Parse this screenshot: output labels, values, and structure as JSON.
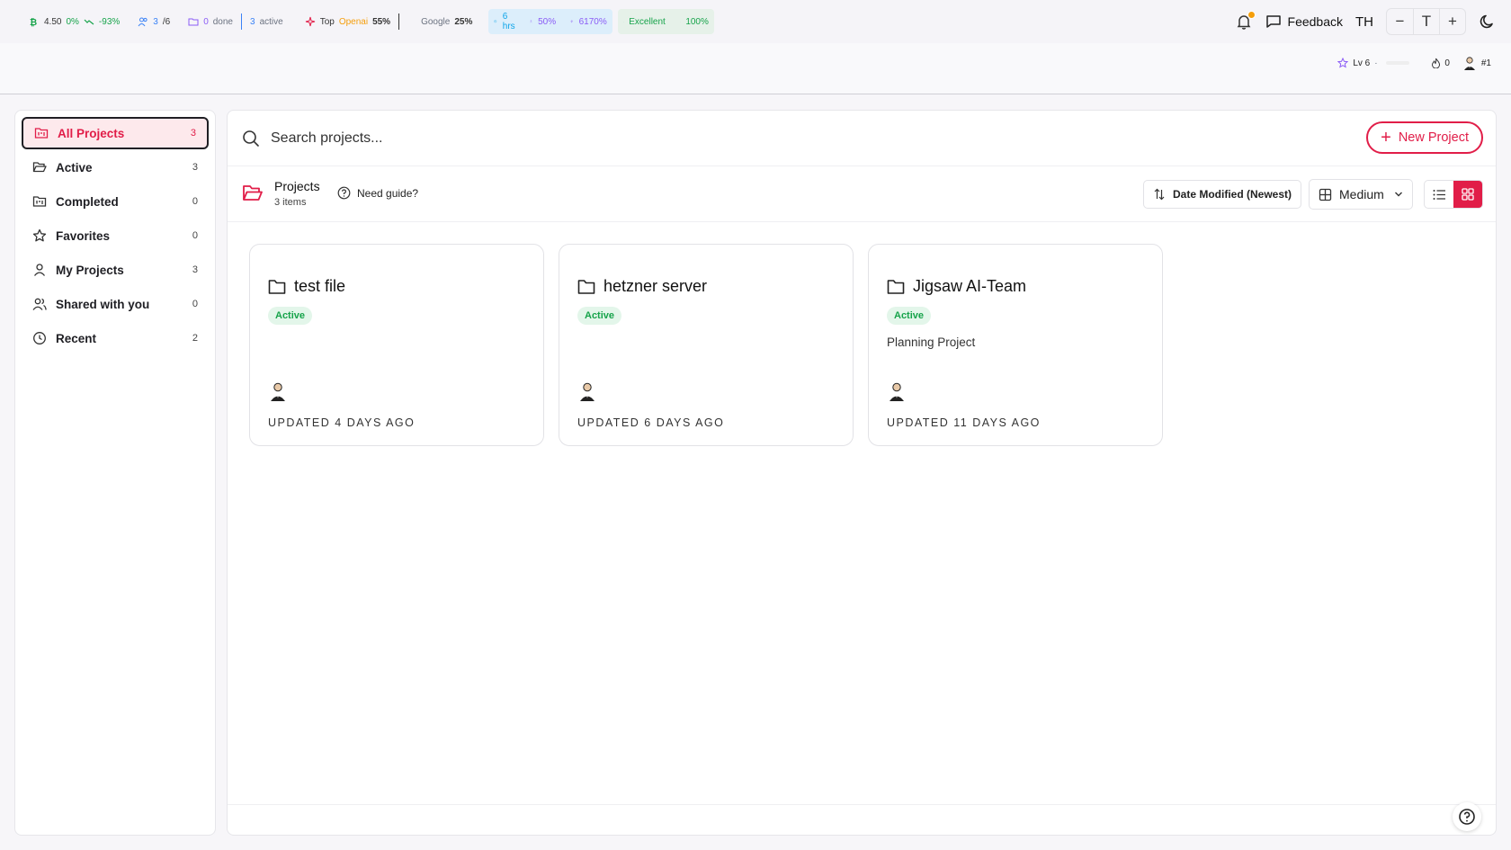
{
  "topbar": {
    "score": "4.50",
    "score_delta": "0%",
    "trend": "-93%",
    "users_now": "3",
    "users_total": "/6",
    "tasks_done_count": "0",
    "tasks_done_label": "done",
    "tasks_active_count": "3",
    "tasks_active_label": "active",
    "top_label": "Top",
    "top_provider": "Openai",
    "top_pct": "55%",
    "second_provider": "Google",
    "second_pct": "25%",
    "hours": "6 hrs",
    "people_pct": "50%",
    "boost_pct": "6170%",
    "quality": "Excellent",
    "growth": "100%"
  },
  "header": {
    "feedback_label": "Feedback",
    "language": "TH",
    "zoom_out": "−",
    "font_label": "T",
    "zoom_in": "+"
  },
  "subbar": {
    "level": "Lv 6",
    "level_dot": "·",
    "streak": "0",
    "rank": "#1"
  },
  "sidebar": {
    "items": [
      {
        "label": "All Projects",
        "count": "3"
      },
      {
        "label": "Active",
        "count": "3"
      },
      {
        "label": "Completed",
        "count": "0"
      },
      {
        "label": "Favorites",
        "count": "0"
      },
      {
        "label": "My Projects",
        "count": "3"
      },
      {
        "label": "Shared with you",
        "count": "0"
      },
      {
        "label": "Recent",
        "count": "2"
      }
    ]
  },
  "search": {
    "placeholder": "Search projects..."
  },
  "actions": {
    "new_project": "New Project"
  },
  "toolbar": {
    "section_title": "Projects",
    "item_count": "3 items",
    "guide": "Need guide?",
    "sort": "Date Modified (Newest)",
    "size": "Medium"
  },
  "projects": [
    {
      "name": "test file",
      "status": "Active",
      "description": "",
      "updated": "UPDATED 4 DAYS AGO"
    },
    {
      "name": "hetzner server",
      "status": "Active",
      "description": "",
      "updated": "UPDATED 6 DAYS AGO"
    },
    {
      "name": "Jigsaw AI-Team",
      "status": "Active",
      "description": "Planning Project",
      "updated": "UPDATED 11 DAYS AGO"
    }
  ],
  "colors": {
    "accent": "#e11d48",
    "active_badge_bg": "#e3f6ea",
    "active_badge_text": "#16a34a"
  }
}
